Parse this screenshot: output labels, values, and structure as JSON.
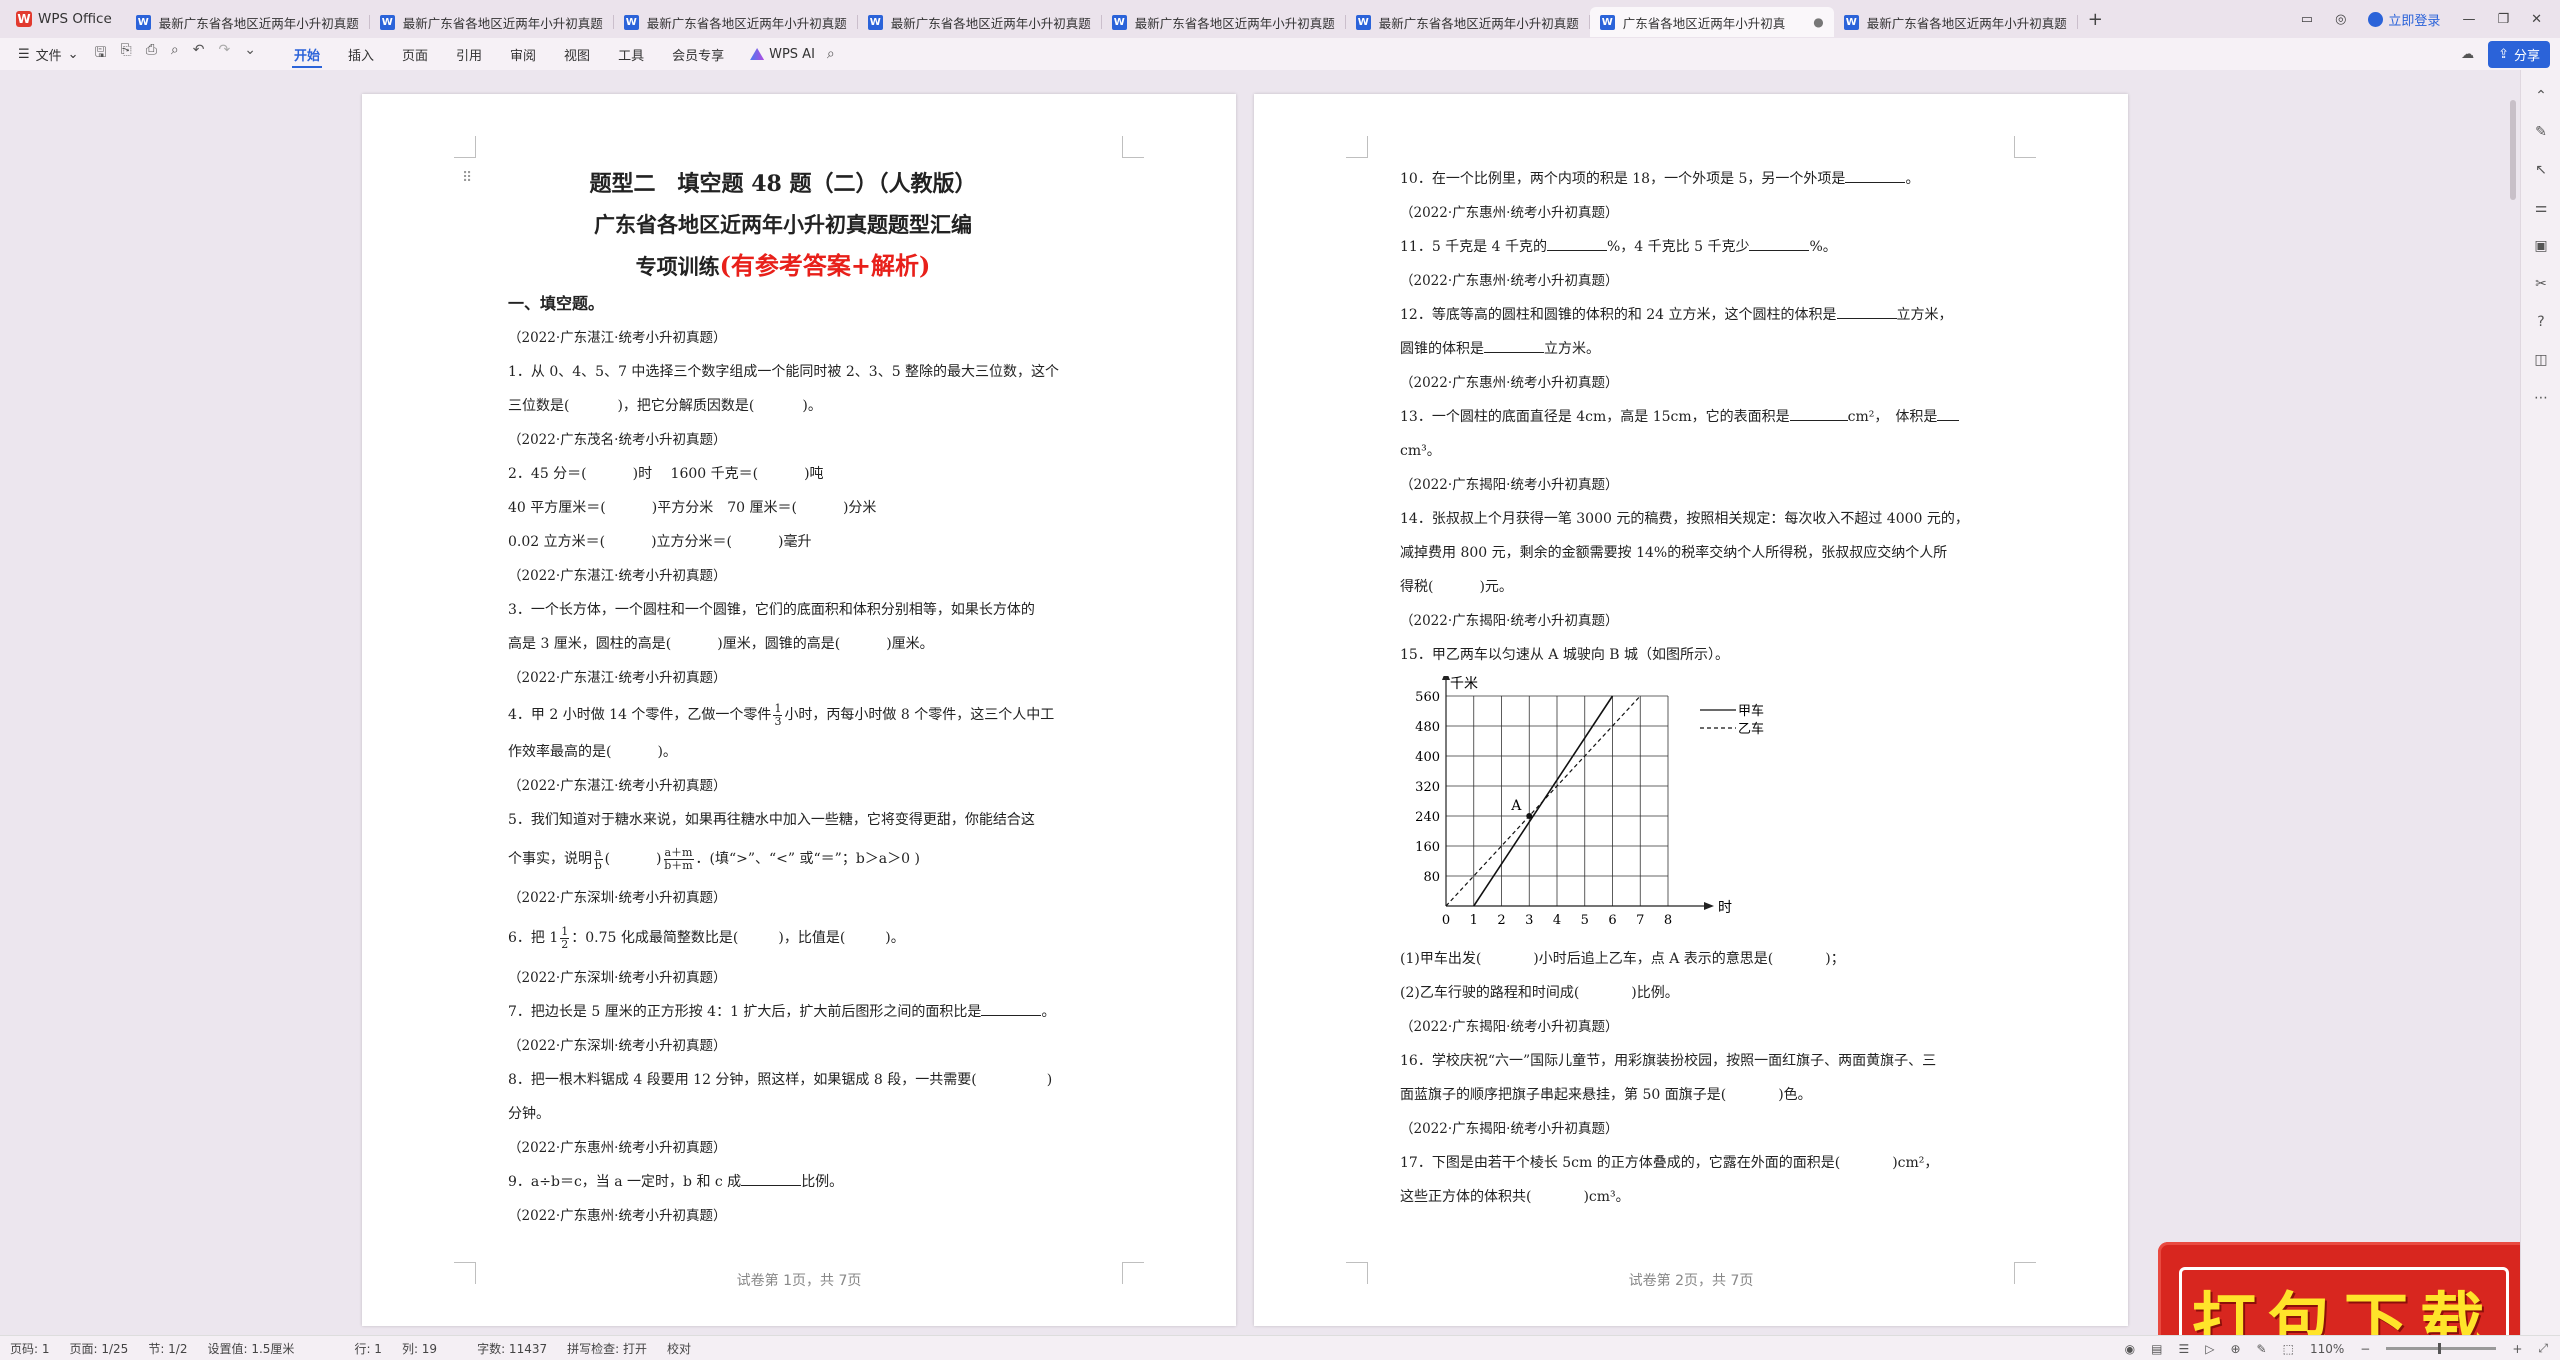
{
  "app": {
    "name": "WPS Office"
  },
  "tabs": [
    {
      "title": "最新广东省各地区近两年小升初真题",
      "active": false
    },
    {
      "title": "最新广东省各地区近两年小升初真题",
      "active": false
    },
    {
      "title": "最新广东省各地区近两年小升初真题",
      "active": false
    },
    {
      "title": "最新广东省各地区近两年小升初真题",
      "active": false
    },
    {
      "title": "最新广东省各地区近两年小升初真题",
      "active": false
    },
    {
      "title": "最新广东省各地区近两年小升初真题",
      "active": false
    },
    {
      "title": "广东省各地区近两年小升初真",
      "active": true
    },
    {
      "title": "最新广东省各地区近两年小升初真题",
      "active": false
    }
  ],
  "window": {
    "login": "立即登录",
    "share": "分享",
    "add_tab": "+"
  },
  "menu": {
    "file": "文件",
    "items": [
      "开始",
      "插入",
      "页面",
      "引用",
      "审阅",
      "视图",
      "工具",
      "会员专享"
    ],
    "ai": "WPS AI"
  },
  "page1": {
    "title1": "题型二　填空题 48 题（二）（人教版）",
    "title2": "广东省各地区近两年小升初真题题型汇编",
    "title3_prefix": "专项训练",
    "title3_red": "(有参考答案+解析)",
    "section": "一、填空题。",
    "footer": "试卷第 1页，共 7页",
    "lines": {
      "s1": "（2022·广东湛江·统考小升初真题）",
      "q1a": "1．从 0、4、5、7 中选择三个数字组成一个能同时被 2、3、5 整除的最大三位数，这个",
      "q1b1": "三位数是(",
      "q1b2": ")，把它分解质因数是(",
      "q1b3": ")。",
      "s2": "（2022·广东茂名·统考小升初真题）",
      "q2a1": "2．45 分＝(",
      "q2a2": ")时　 1600 千克＝(",
      "q2a3": ")吨",
      "q2b1": "40 平方厘米＝(",
      "q2b2": ")平方分米　70 厘米＝(",
      "q2b3": ")分米",
      "q2c1": "0.02 立方米＝(",
      "q2c2": ")立方分米＝(",
      "q2c3": ")毫升",
      "s3": "（2022·广东湛江·统考小升初真题）",
      "q3a": "3．一个长方体，一个圆柱和一个圆锥，它们的底面积和体积分别相等，如果长方体的",
      "q3b1": "高是 3 厘米，圆柱的高是(",
      "q3b2": ")厘米，圆锥的高是(",
      "q3b3": ")厘米。",
      "s4": "（2022·广东湛江·统考小升初真题）",
      "q4a1": "4．甲 2 小时做 14 个零件，乙做一个零件",
      "q4a_fn": "1",
      "q4a_fd": "3",
      "q4a2": "小时，丙每小时做 8 个零件，这三个人中工",
      "q4b1": "作效率最高的是(",
      "q4b2": ")。",
      "s5": "（2022·广东湛江·统考小升初真题）",
      "q5a": "5．我们知道对于糖水来说，如果再往糖水中加入一些糖，它将变得更甜，你能结合这",
      "q5b1": "个事实，说明",
      "q5b_fn1": "a",
      "q5b_fd1": "b",
      "q5b2": "(",
      "q5b3": ")",
      "q5b_fn2": "a＋m",
      "q5b_fd2": "b＋m",
      "q5b4": "．(填“>”、“<” 或“＝”；b＞a＞0 )",
      "s6": "（2022·广东深圳·统考小升初真题）",
      "q6a1": "6．把 1",
      "q6a_fn": "1",
      "q6a_fd": "2",
      "q6a2": "：0.75 化成最简整数比是(",
      "q6a3": ")，比值是(",
      "q6a4": ")。",
      "s7": "（2022·广东深圳·统考小升初真题）",
      "q7a1": "7．把边长是 5 厘米的正方形按 4：1 扩大后，扩大前后图形之间的面积比是",
      "q7a2": "。",
      "s8": "（2022·广东深圳·统考小升初真题）",
      "q8a1": "8．把一根木料锯成 4 段要用 12 分钟，照这样，如果锯成 8 段，一共需要(",
      "q8a2": ")",
      "q8b": "分钟。",
      "s9": "（2022·广东惠州·统考小升初真题）",
      "q9a1": "9．a÷b＝c，当 a 一定时，b 和 c 成",
      "q9a2": "比例。",
      "s10": "（2022·广东惠州·统考小升初真题）"
    }
  },
  "page2": {
    "footer": "试卷第 2页，共 7页",
    "lines": {
      "q10a1": "10．在一个比例里，两个内项的积是 18，一个外项是 5，另一个外项是",
      "q10a2": "。",
      "s11": "（2022·广东惠州·统考小升初真题）",
      "q11a1": "11．5 千克是 4 千克的",
      "q11a2": "%，4 千克比 5 千克少",
      "q11a3": "%。",
      "s12": "（2022·广东惠州·统考小升初真题）",
      "q12a1": "12．等底等高的圆柱和圆锥的体积的和 24 立方米，这个圆柱的体积是",
      "q12a2": "立方米，",
      "q12b1": "圆锥的体积是",
      "q12b2": "立方米。",
      "s13": "（2022·广东惠州·统考小升初真题）",
      "q13a1": "13．一个圆柱的底面直径是 4cm，高是 15cm，它的表面积是",
      "q13a2": "cm²，　体积是",
      "q13b": "cm³。",
      "s14": "（2022·广东揭阳·统考小升初真题）",
      "q14a": "14．张叔叔上个月获得一笔 3000 元的稿费，按照相关规定：每次收入不超过 4000 元的，",
      "q14b": "减掉费用 800 元，剩余的金额需要按 14%的税率交纳个人所得税，张叔叔应交纳个人所",
      "q14c1": "得税(",
      "q14c2": ")元。",
      "s15": "（2022·广东揭阳·统考小升初真题）",
      "q15a": "15．甲乙两车以匀速从 A 城驶向 B 城（如图所示）。",
      "q15b1": "(1)甲车出发(",
      "q15b2": ")小时后追上乙车，点 A 表示的意思是(",
      "q15b3": ")；",
      "q15c1": "(2)乙车行驶的路程和时间成(",
      "q15c2": ")比例。",
      "s16": "（2022·广东揭阳·统考小升初真题）",
      "q16a": "16．学校庆祝“六一”国际儿童节，用彩旗装扮校园，按照一面红旗子、两面黄旗子、三",
      "q16b1": "面蓝旗子的顺序把旗子串起来悬挂，第 50 面旗子是(",
      "q16b2": ")色。",
      "s17": "（2022·广东揭阳·统考小升初真题）",
      "q17a1": "17．下图是由若干个棱长 5cm 的正方体叠成的，它露在外面的面积是(",
      "q17a2": ")cm²，",
      "q17b1": "这些正方体的体积共(",
      "q17b2": ")cm³。"
    }
  },
  "chart_data": {
    "type": "line",
    "ylabel": "千米",
    "xlabel": "时",
    "x_ticks": [
      0,
      1,
      2,
      3,
      4,
      5,
      6,
      7,
      8
    ],
    "y_ticks": [
      0,
      80,
      160,
      240,
      320,
      400,
      480,
      560
    ],
    "xlim": [
      0,
      8
    ],
    "ylim": [
      0,
      560
    ],
    "grid": true,
    "legend_position": "top-right",
    "annotation": {
      "label": "A",
      "x": 3,
      "y": 240
    },
    "series": [
      {
        "name": "甲车",
        "style": "solid",
        "points": [
          [
            1,
            0
          ],
          [
            6,
            560
          ]
        ]
      },
      {
        "name": "乙车",
        "style": "dashed",
        "points": [
          [
            0,
            0
          ],
          [
            7,
            560
          ]
        ]
      }
    ]
  },
  "status": {
    "page_num": "页码: 1",
    "pages": "页面: 1/25",
    "section": "节: 1/2",
    "setting": "设置值: 1.5厘米",
    "row": "行: 1",
    "col": "列: 19",
    "words": "字数: 11437",
    "spell": "拼写检查: 打开",
    "proof": "校对",
    "zoom": "110%"
  },
  "banner": {
    "text": "打包下载"
  }
}
